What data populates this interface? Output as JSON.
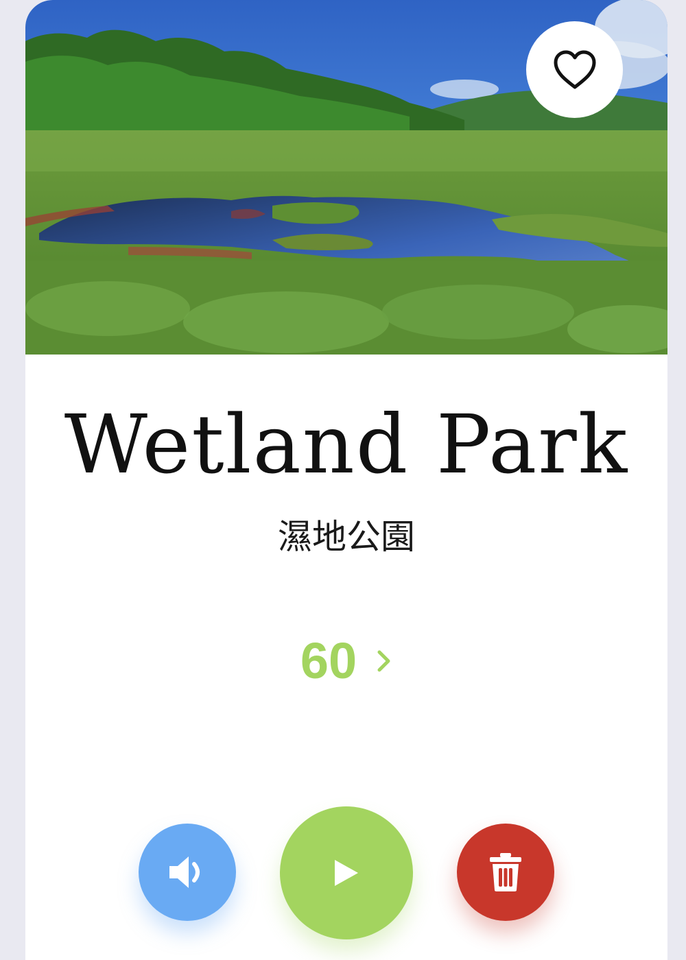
{
  "place": {
    "title": "Wetland Park",
    "subtitle": "濕地公園",
    "count": "60"
  },
  "icons": {
    "favorite": "heart-outline-icon",
    "more": "chevron-right-icon",
    "sound": "speaker-icon",
    "play": "play-icon",
    "delete": "trash-icon"
  },
  "colors": {
    "accent_green": "#a3d45f",
    "sound_blue": "#69aaf3",
    "delete_red": "#c8372b",
    "page_background": "#e9e9f1"
  }
}
